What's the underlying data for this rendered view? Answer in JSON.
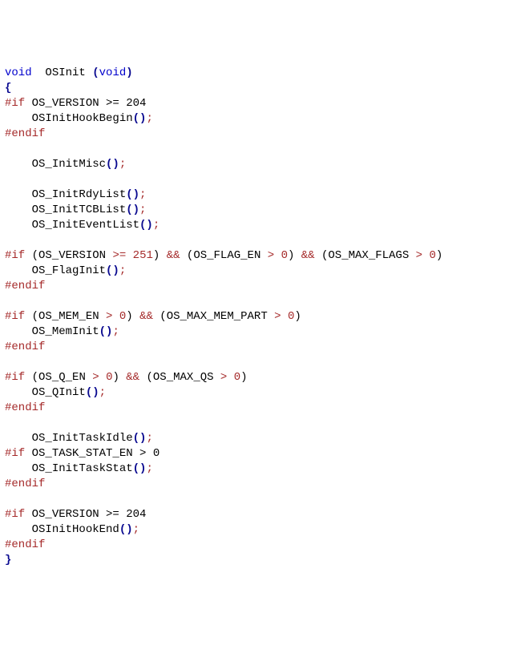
{
  "code": {
    "l1": {
      "kw1": "void",
      "sp": "  ",
      "fn": "OSInit ",
      "p1": "(",
      "kw2": "void",
      "p2": ")"
    },
    "l2": {
      "brace": "{"
    },
    "l3": {
      "pp": "#if",
      "cond": " OS_VERSION >= 204"
    },
    "l4": {
      "ind": "    ",
      "fn": "OSInitHookBegin",
      "p1": "()",
      "semi": ";"
    },
    "l5": {
      "pp": "#endif"
    },
    "l7": {
      "ind": "    ",
      "fn": "OS_InitMisc",
      "p1": "()",
      "semi": ";"
    },
    "l9": {
      "ind": "    ",
      "fn": "OS_InitRdyList",
      "p1": "()",
      "semi": ";"
    },
    "l10": {
      "ind": "    ",
      "fn": "OS_InitTCBList",
      "p1": "()",
      "semi": ";"
    },
    "l11": {
      "ind": "    ",
      "fn": "OS_InitEventList",
      "p1": "()",
      "semi": ";"
    },
    "l13": {
      "pp": "#if",
      "open": " (",
      "id1": "OS_VERSION ",
      "op1": ">= ",
      "n1": "251",
      "cl1": ") ",
      "op2": "&& ",
      "op2b": "(",
      "id2": "OS_FLAG_EN ",
      "op3": "> ",
      "n2": "0",
      "cl2": ") ",
      "op4": "&& ",
      "op4b": "(",
      "id3": "OS_MAX_FLAGS ",
      "op5": "> ",
      "n3": "0",
      "cl3": ")"
    },
    "l14": {
      "ind": "    ",
      "fn": "OS_FlagInit",
      "p1": "()",
      "semi": ";"
    },
    "l15": {
      "pp": "#endif"
    },
    "l17": {
      "pp": "#if",
      "open": " (",
      "id1": "OS_MEM_EN ",
      "op1": "> ",
      "n1": "0",
      "cl1": ") ",
      "op2": "&& ",
      "op2b": "(",
      "id2": "OS_MAX_MEM_PART ",
      "op3": "> ",
      "n2": "0",
      "cl2": ")"
    },
    "l18": {
      "ind": "    ",
      "fn": "OS_MemInit",
      "p1": "()",
      "semi": ";"
    },
    "l19": {
      "pp": "#endif"
    },
    "l21": {
      "pp": "#if",
      "open": " (",
      "id1": "OS_Q_EN ",
      "op1": "> ",
      "n1": "0",
      "cl1": ") ",
      "op2": "&& ",
      "op2b": "(",
      "id2": "OS_MAX_QS ",
      "op3": "> ",
      "n2": "0",
      "cl2": ")"
    },
    "l22": {
      "ind": "    ",
      "fn": "OS_QInit",
      "p1": "()",
      "semi": ";"
    },
    "l23": {
      "pp": "#endif"
    },
    "l25": {
      "ind": "    ",
      "fn": "OS_InitTaskIdle",
      "p1": "()",
      "semi": ";"
    },
    "l26": {
      "pp": "#if",
      "cond": " OS_TASK_STAT_EN > 0"
    },
    "l27": {
      "ind": "    ",
      "fn": "OS_InitTaskStat",
      "p1": "()",
      "semi": ";"
    },
    "l28": {
      "pp": "#endif"
    },
    "l30": {
      "pp": "#if",
      "cond": " OS_VERSION >= 204"
    },
    "l31": {
      "ind": "    ",
      "fn": "OSInitHookEnd",
      "p1": "()",
      "semi": ";"
    },
    "l32": {
      "pp": "#endif"
    },
    "l33": {
      "brace": "}"
    }
  }
}
